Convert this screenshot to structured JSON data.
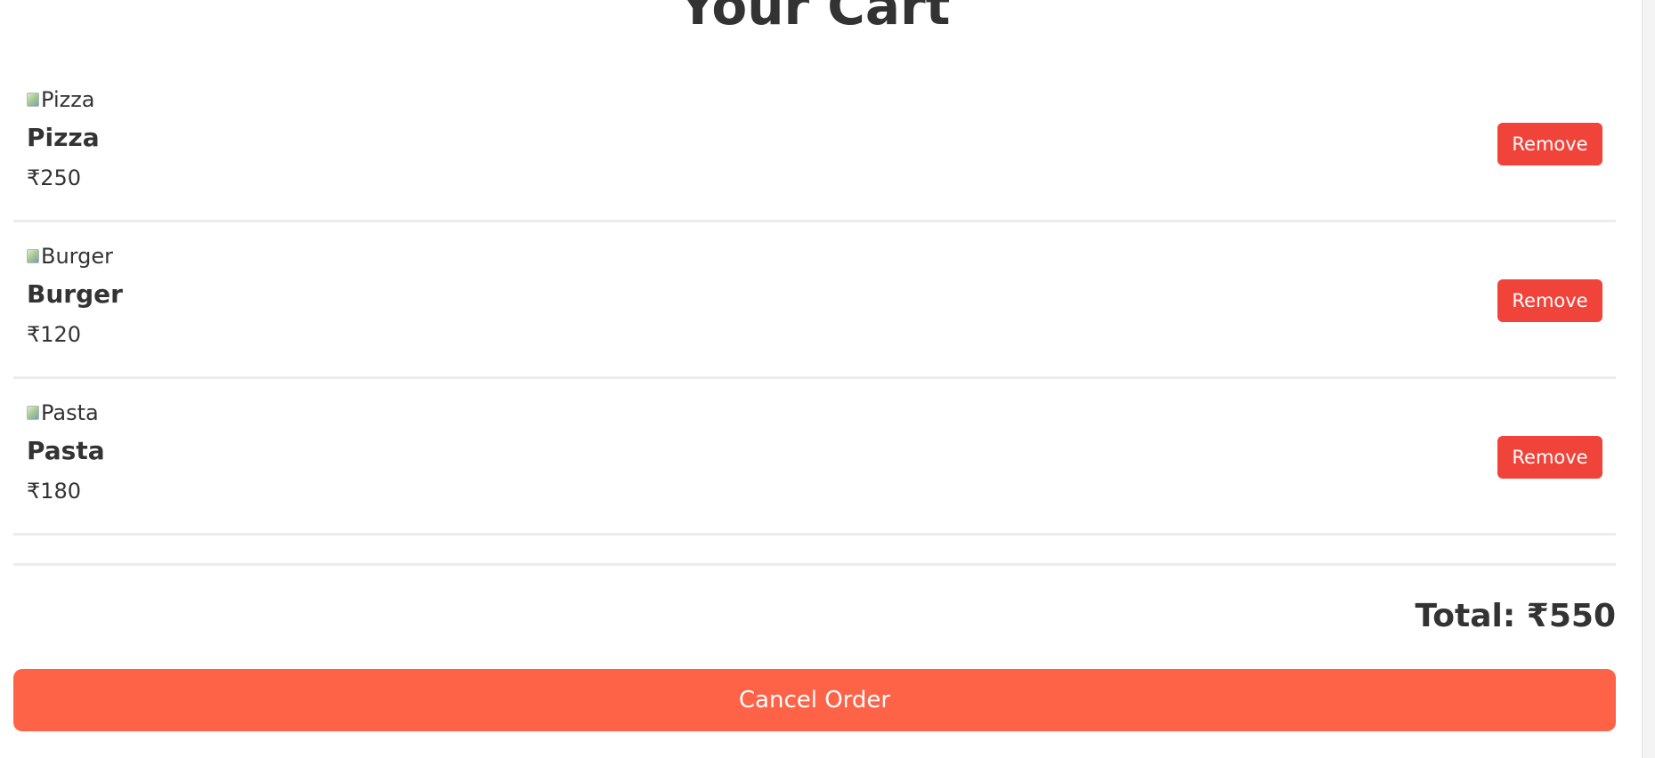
{
  "page": {
    "title": "Your Cart"
  },
  "cart": {
    "items": [
      {
        "img_alt": "Pizza",
        "name": "Pizza",
        "price": "₹250",
        "remove_label": "Remove"
      },
      {
        "img_alt": "Burger",
        "name": "Burger",
        "price": "₹120",
        "remove_label": "Remove"
      },
      {
        "img_alt": "Pasta",
        "name": "Pasta",
        "price": "₹180",
        "remove_label": "Remove"
      }
    ],
    "total": "Total: ₹550",
    "cancel_label": "Cancel Order"
  },
  "colors": {
    "remove_button": "#f0433a",
    "cancel_button": "#ff6347",
    "divider": "#ececec",
    "text": "#333333"
  }
}
